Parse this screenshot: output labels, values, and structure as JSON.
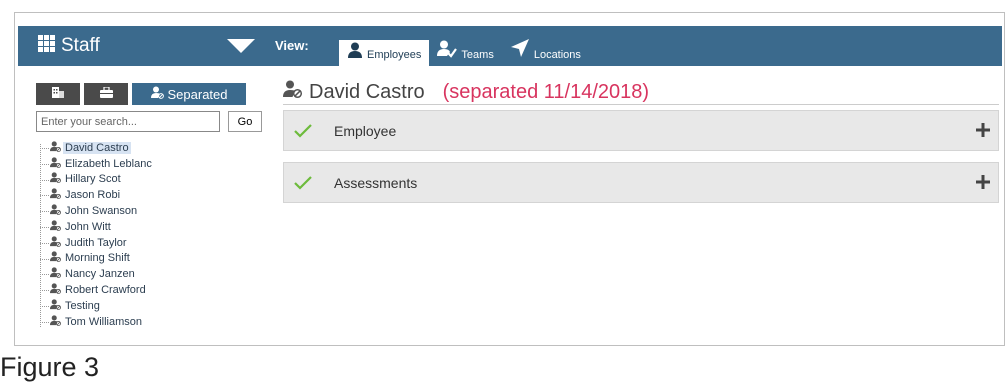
{
  "header": {
    "app_label": "Staff",
    "view_label": "View:",
    "tabs": [
      {
        "label": "Employees",
        "icon": "person-icon",
        "active": true
      },
      {
        "label": "Teams",
        "icon": "team-icon",
        "active": false
      },
      {
        "label": "Locations",
        "icon": "location-arrow-icon",
        "active": false
      }
    ]
  },
  "sidebar": {
    "filter_tabs": [
      {
        "icon": "building-icon",
        "label": ""
      },
      {
        "icon": "briefcase-icon",
        "label": ""
      },
      {
        "icon": "separated-user-icon",
        "label": "Separated",
        "active": true
      }
    ],
    "search": {
      "placeholder": "Enter your search...",
      "go_label": "Go"
    },
    "tree_items": [
      "David Castro",
      "Elizabeth Leblanc",
      "Hillary Scot",
      "Jason Robi",
      "John Swanson",
      "John Witt",
      "Judith Taylor",
      "Morning Shift",
      "Nancy Janzen",
      "Robert Crawford",
      "Testing",
      "Tom Williamson"
    ],
    "selected_index": 0
  },
  "main": {
    "employee_name": "David Castro",
    "status": "(separated 11/14/2018)",
    "panels": [
      {
        "label": "Employee"
      },
      {
        "label": "Assessments"
      }
    ]
  },
  "caption": "Figure 3",
  "colors": {
    "topbar": "#3b6a8d",
    "status_text": "#d8345f",
    "check": "#6dbb3c",
    "panel_bg": "#e8e8e8",
    "selected_bg": "#d7e3f2"
  }
}
